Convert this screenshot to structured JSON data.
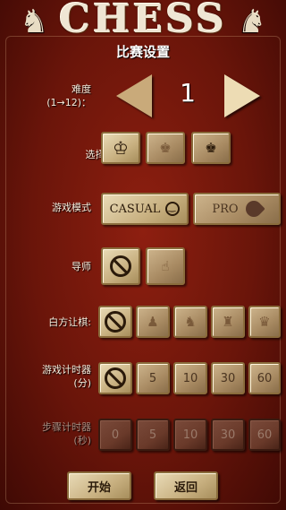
{
  "header": {
    "logo_text": "CHESS",
    "subtitle": "比赛设置"
  },
  "difficulty": {
    "label": "难度\n(1→12)：",
    "value": "1"
  },
  "choose": {
    "label": "选择..."
  },
  "mode": {
    "label": "游戏模式",
    "casual": "CASUAL",
    "pro": "PRO"
  },
  "mentor": {
    "label": "导师"
  },
  "handicap": {
    "label": "白方让棋:"
  },
  "game_timer": {
    "label": "游戏计时器\n(分)",
    "options": [
      "5",
      "10",
      "30",
      "60"
    ]
  },
  "move_timer": {
    "label": "步骤计时器\n(秒)",
    "options": [
      "0",
      "5",
      "10",
      "30",
      "60"
    ]
  },
  "buttons": {
    "start": "开始",
    "back": "返回"
  },
  "colors": {
    "background": "#6a150a",
    "tile": "#d8c49c"
  }
}
